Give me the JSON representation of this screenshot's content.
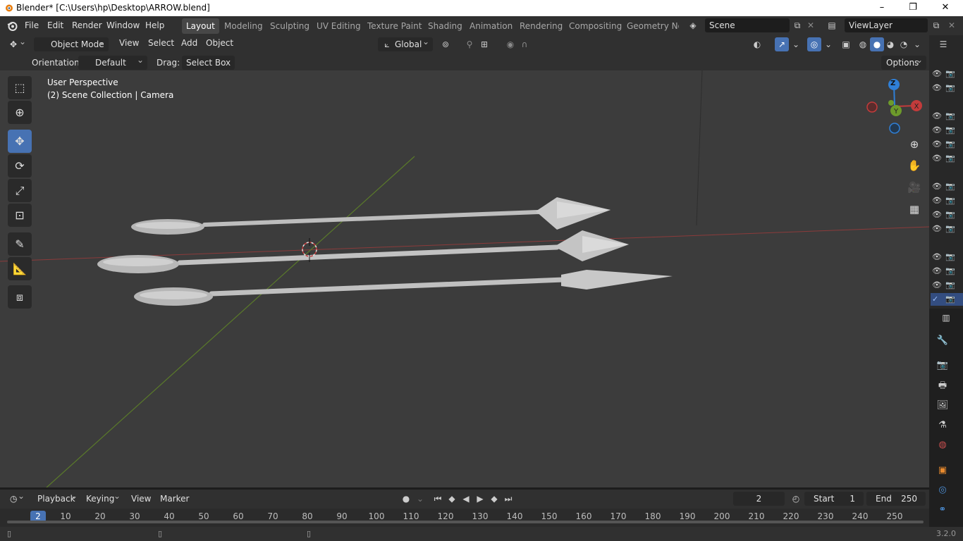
{
  "window": {
    "title": "Blender* [C:\\Users\\hp\\Desktop\\ARROW.blend]",
    "controls": [
      "–",
      "❐",
      "✕"
    ]
  },
  "menu": [
    "File",
    "Edit",
    "Render",
    "Window",
    "Help"
  ],
  "workspaces": [
    "Layout",
    "Modeling",
    "Sculpting",
    "UV Editing",
    "Texture Paint",
    "Shading",
    "Animation",
    "Rendering",
    "Compositing",
    "Geometry Noc"
  ],
  "active_workspace": "Layout",
  "scene": {
    "name": "Scene"
  },
  "view_layer": {
    "name": "ViewLayer"
  },
  "header": {
    "mode": "Object Mode",
    "menus": [
      "View",
      "Select",
      "Add",
      "Object"
    ],
    "transform_orientation": "Global"
  },
  "tool_settings": {
    "orientation_label": "Orientation:",
    "orientation_value": "Default",
    "drag_label": "Drag:",
    "drag_value": "Select Box",
    "options_label": "Options"
  },
  "viewport": {
    "perspective": "User Perspective",
    "context": "(2) Scene Collection | Camera",
    "gizmo_z": "Z"
  },
  "timeline": {
    "playback": "Playback",
    "keying": "Keying",
    "view": "View",
    "marker": "Marker",
    "current_frame": "2",
    "start_label": "Start",
    "start_value": "1",
    "end_label": "End",
    "end_value": "250",
    "ruler_current": "2",
    "ruler_ticks": [
      "10",
      "20",
      "30",
      "40",
      "50",
      "60",
      "70",
      "80",
      "90",
      "100",
      "110",
      "120",
      "130",
      "140",
      "150",
      "160",
      "170",
      "180",
      "190",
      "200",
      "210",
      "220",
      "230",
      "240",
      "250"
    ]
  },
  "status": {
    "version": "3.2.0"
  },
  "colors": {
    "accent": "#4772b3",
    "x_axis": "#c33b3b",
    "y_axis": "#6d9a2b",
    "z_axis": "#2f7fd6"
  },
  "icons": {
    "select": "select-box-icon",
    "cursor": "cursor-icon",
    "move": "move-icon",
    "rotate": "rotate-icon",
    "scale": "scale-icon",
    "transform": "transform-icon",
    "annotate": "annotate-icon",
    "measure": "measure-icon",
    "add_cube": "add-cube-icon"
  }
}
